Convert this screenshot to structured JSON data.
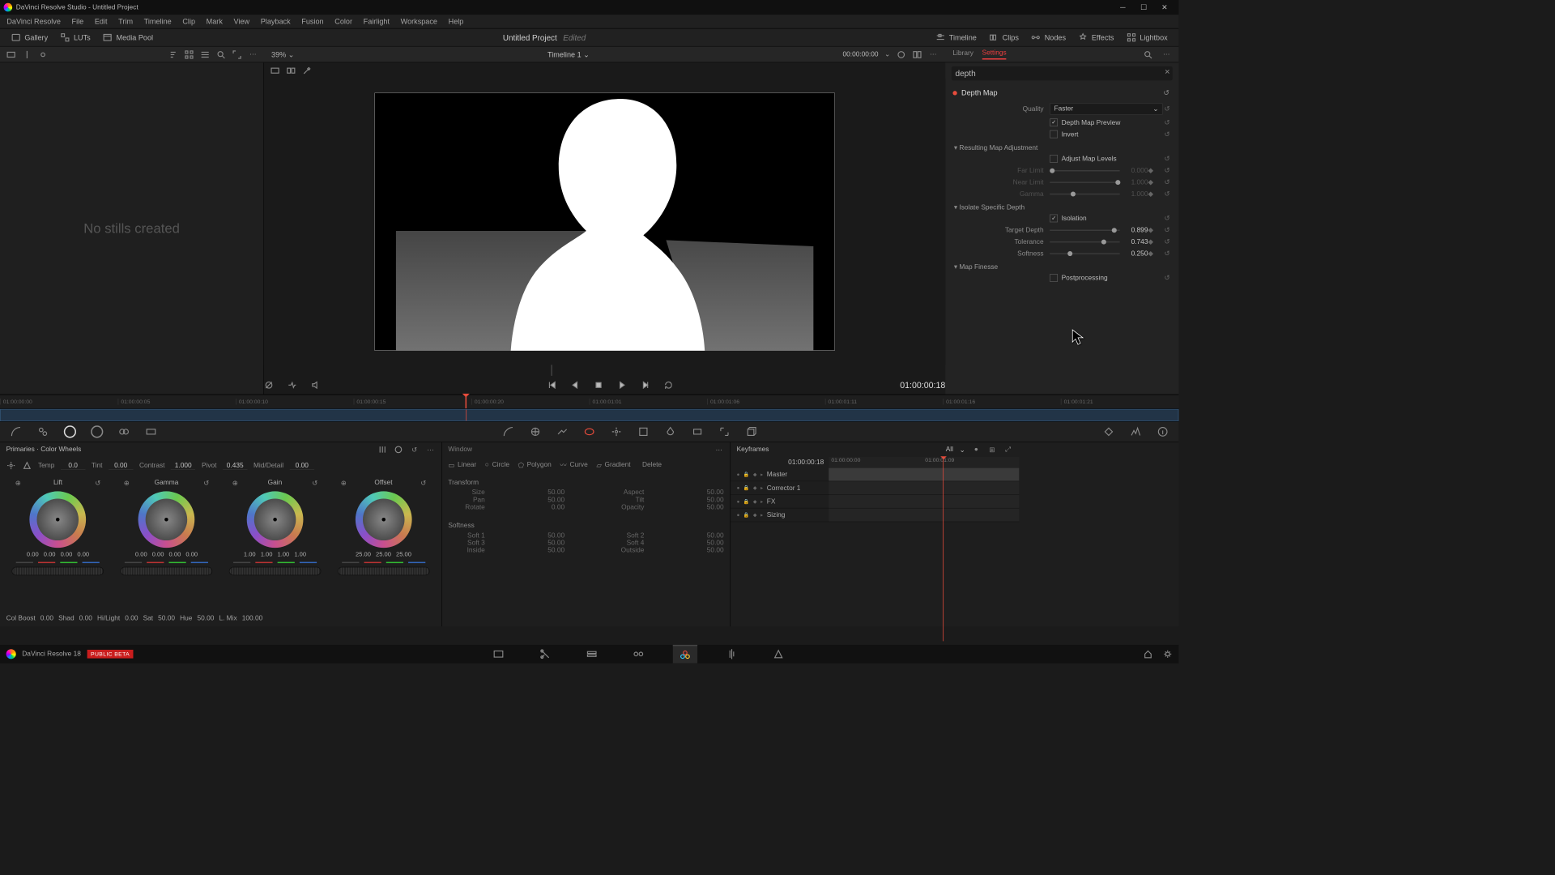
{
  "window": {
    "title2": "Window",
    "tools": [
      "Linear",
      "Circle",
      "Polygon",
      "Curve",
      "Gradient",
      "Delete"
    ]
  },
  "menu": [
    "DaVinci Resolve",
    "File",
    "Edit",
    "Trim",
    "Timeline",
    "Clip",
    "Mark",
    "View",
    "Playback",
    "Fusion",
    "Color",
    "Fairlight",
    "Workspace",
    "Help"
  ],
  "topbar": {
    "gallery": "Gallery",
    "luts": "LUTs",
    "mediapool": "Media Pool",
    "project": "Untitled Project",
    "edited": "Edited",
    "timeline": "Timeline",
    "clips": "Clips",
    "nodes": "Nodes",
    "effects": "Effects",
    "lightbox": "Lightbox"
  },
  "subbar": {
    "zoom": "39%",
    "timeline": "Timeline 1",
    "tc": "00:00:00:00",
    "lib": "Library",
    "settings": "Settings"
  },
  "inspector": {
    "search": "depth",
    "title": "Depth Map",
    "quality_lbl": "Quality",
    "quality_val": "Faster",
    "preview": "Depth Map Preview",
    "invert": "Invert",
    "sect_adj": "Resulting Map Adjustment",
    "adjust": "Adjust Map Levels",
    "far_lbl": "Far Limit",
    "far_val": "0.000",
    "near_lbl": "Near Limit",
    "near_val": "1.000",
    "gamma_lbl": "Gamma",
    "gamma_val": "1.000",
    "sect_iso": "Isolate Specific Depth",
    "isolation": "Isolation",
    "td_lbl": "Target Depth",
    "td_val": "0.899",
    "tol_lbl": "Tolerance",
    "tol_val": "0.743",
    "soft_lbl": "Softness",
    "soft_val": "0.250",
    "sect_fin": "Map Finesse",
    "post": "Postprocessing"
  },
  "transport_tc": "01:00:00:18",
  "ruler": [
    "01:00:00:00",
    "01:00:00:05",
    "01:00:00:10",
    "01:00:00:15",
    "01:00:00:20",
    "01:00:01:01",
    "01:00:01:06",
    "01:00:01:11",
    "01:00:01:16",
    "01:00:01:21"
  ],
  "stills": "No stills created",
  "primaries": {
    "title": "Primaries · Color Wheels",
    "top": [
      [
        "Temp",
        "0.0"
      ],
      [
        "Tint",
        "0.00"
      ],
      [
        "Contrast",
        "1.000"
      ],
      [
        "Pivot",
        "0.435"
      ],
      [
        "Mid/Detail",
        "0.00"
      ]
    ],
    "wheels": [
      {
        "name": "Lift",
        "vals": [
          "0.00",
          "0.00",
          "0.00",
          "0.00"
        ]
      },
      {
        "name": "Gamma",
        "vals": [
          "0.00",
          "0.00",
          "0.00",
          "0.00"
        ]
      },
      {
        "name": "Gain",
        "vals": [
          "1.00",
          "1.00",
          "1.00",
          "1.00"
        ]
      },
      {
        "name": "Offset",
        "vals": [
          "25.00",
          "25.00",
          "25.00"
        ]
      }
    ],
    "bot": [
      [
        "Col Boost",
        "0.00"
      ],
      [
        "Shad",
        "0.00"
      ],
      [
        "Hi/Light",
        "0.00"
      ],
      [
        "Sat",
        "50.00"
      ],
      [
        "Hue",
        "50.00"
      ],
      [
        "L. Mix",
        "100.00"
      ]
    ]
  },
  "transform": {
    "title": "Transform",
    "rows": [
      [
        "Size",
        "50.00",
        "Aspect",
        "50.00"
      ],
      [
        "Pan",
        "50.00",
        "Tilt",
        "50.00"
      ],
      [
        "Rotate",
        "0.00",
        "Opacity",
        "50.00"
      ]
    ],
    "soft_title": "Softness",
    "srows": [
      [
        "Soft 1",
        "50.00",
        "Soft 2",
        "50.00"
      ],
      [
        "Soft 3",
        "50.00",
        "Soft 4",
        "50.00"
      ],
      [
        "Inside",
        "50.00",
        "Outside",
        "50.00"
      ]
    ]
  },
  "kf": {
    "title": "Keyframes",
    "all": "All",
    "tc": "01:00:00:18",
    "ru": [
      "01:00:00:00",
      "01:00:01:09"
    ],
    "rows": [
      "Master",
      "Corrector 1",
      "FX",
      "Sizing"
    ]
  },
  "pagebar": {
    "app": "DaVinci Resolve 18",
    "badge": "PUBLIC BETA"
  },
  "win_title": "DaVinci Resolve Studio - Untitled Project"
}
